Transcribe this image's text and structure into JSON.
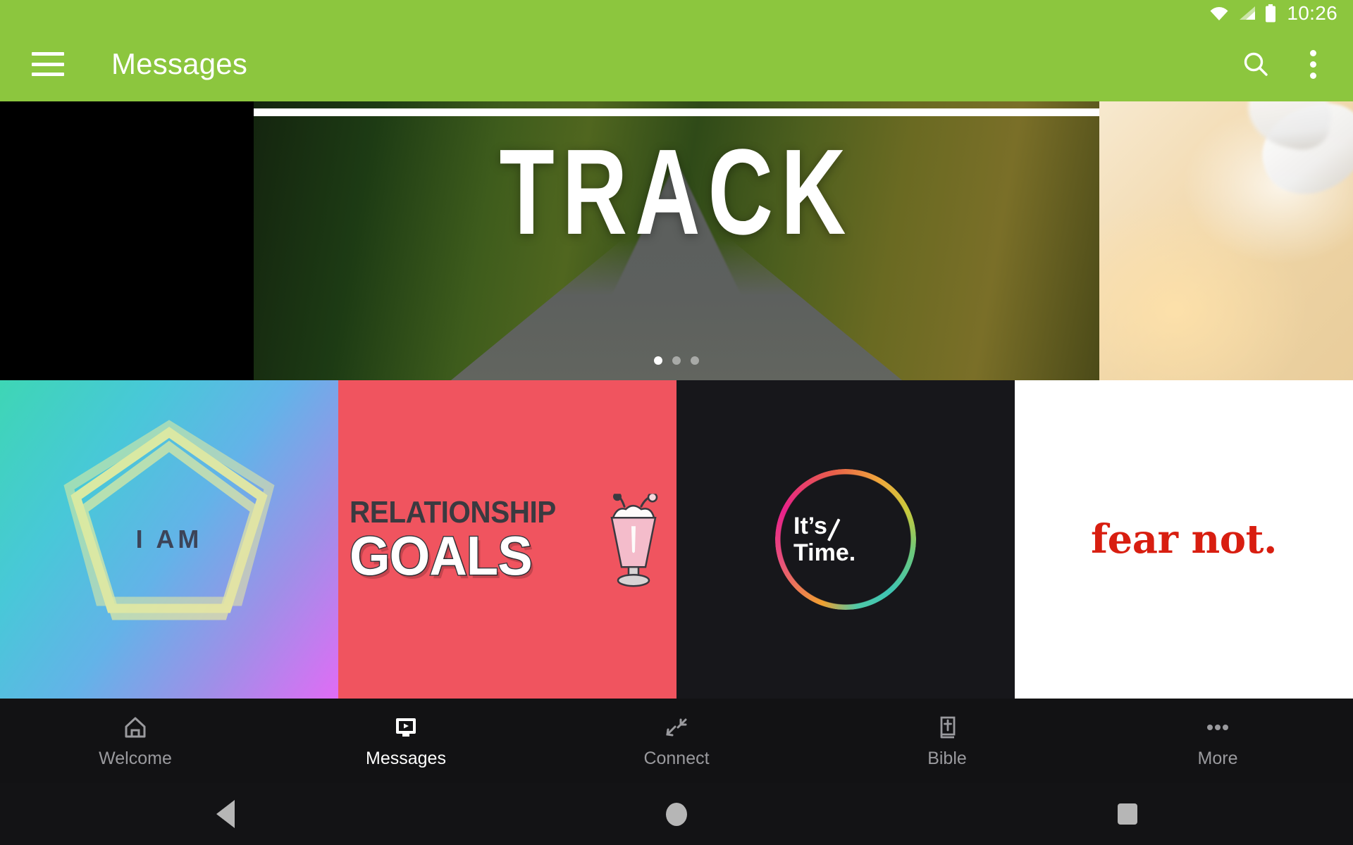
{
  "status_bar": {
    "time": "10:26",
    "icons": [
      "wifi-icon",
      "cellular-signal-icon",
      "battery-icon"
    ]
  },
  "app_bar": {
    "menu_icon": "hamburger-menu-icon",
    "title": "Messages",
    "search_icon": "search-icon",
    "overflow_icon": "overflow-menu-icon",
    "background_color": "#8CC63E"
  },
  "carousel": {
    "active_slide_title": "TRACK",
    "slide_count": 3,
    "active_index": 0,
    "dots": [
      "active",
      "inactive",
      "inactive"
    ]
  },
  "tiles": [
    {
      "name": "i-am",
      "label": "I AM",
      "background_color": "#48C8D8",
      "text_color": "#3C4458"
    },
    {
      "name": "relationship-goals",
      "line1": "RELATIONSHIP",
      "line2": "GOALS",
      "background_color": "#F0545F",
      "text_color": "#FFFFFF",
      "accent_icon": "milkshake-icon"
    },
    {
      "name": "its-time",
      "line1": "It’s",
      "line2": "Time.",
      "background_color": "#17171B",
      "text_color": "#FFFFFF",
      "accent_icon": "gradient-ring-icon"
    },
    {
      "name": "fear-not",
      "label": "fear not.",
      "background_color": "#FFFFFF",
      "text_color": "#D81E10"
    }
  ],
  "bottom_nav": {
    "items": [
      {
        "label": "Welcome",
        "icon": "home-icon",
        "active": false
      },
      {
        "label": "Messages",
        "icon": "video-screen-icon",
        "active": true
      },
      {
        "label": "Connect",
        "icon": "connect-arrows-icon",
        "active": false
      },
      {
        "label": "Bible",
        "icon": "bible-book-icon",
        "active": false
      },
      {
        "label": "More",
        "icon": "more-dots-icon",
        "active": false
      }
    ],
    "active_color": "#FFFFFF",
    "inactive_color": "#9A9A9E",
    "background_color": "#121214"
  },
  "system_nav": {
    "back": "back-triangle-icon",
    "home": "home-circle-icon",
    "recents": "recents-square-icon"
  }
}
